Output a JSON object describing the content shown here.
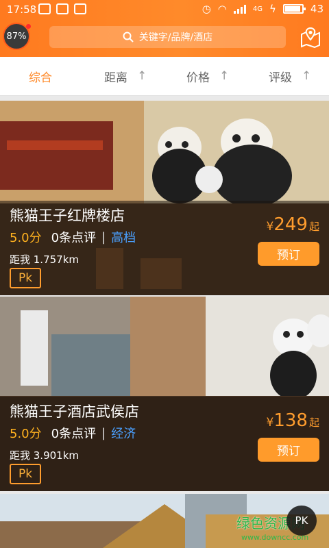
{
  "status_bar": {
    "time": "17:58",
    "network": "4G",
    "battery": "43"
  },
  "header": {
    "percent_badge": "87%",
    "search_placeholder": "关键字/品牌/酒店"
  },
  "sort_tabs": [
    {
      "label": "综合",
      "active": true
    },
    {
      "label": "距离",
      "arrow": "↑"
    },
    {
      "label": "价格",
      "arrow": "↑"
    },
    {
      "label": "评级",
      "arrow": "↑"
    }
  ],
  "hotels": [
    {
      "name": "熊猫王子红牌楼店",
      "score": "5.0分",
      "reviews": "0条点评",
      "grade": "高档",
      "distance": "距我 1.757km",
      "pk": "Pk",
      "currency": "¥",
      "price": "249",
      "price_suffix": "起",
      "book": "预订"
    },
    {
      "name": "熊猫王子酒店武侯店",
      "score": "5.0分",
      "reviews": "0条点评",
      "grade": "经济",
      "distance": "距我 3.901km",
      "pk": "Pk",
      "currency": "¥",
      "price": "138",
      "price_suffix": "起",
      "book": "预订"
    }
  ],
  "floating_pk": "PK",
  "watermark": {
    "text": "绿色资源网",
    "url": "www.downcc.com"
  },
  "colors": {
    "accent": "#ff8a2a",
    "grade_link": "#4aa0ff",
    "score": "#ffb11f"
  }
}
